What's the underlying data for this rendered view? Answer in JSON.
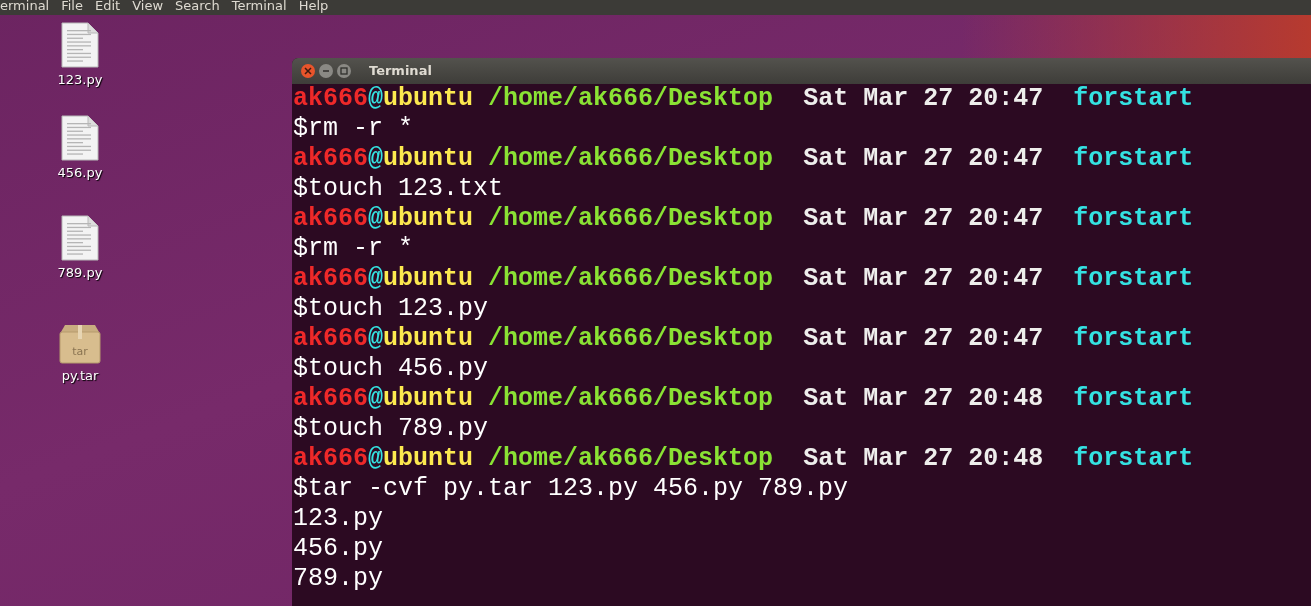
{
  "menu_bar": {
    "items": [
      "erminal",
      "File",
      "Edit",
      "View",
      "Search",
      "Terminal",
      "Help"
    ]
  },
  "desktop_icons": [
    {
      "label": "123.py",
      "kind": "document"
    },
    {
      "label": "456.py",
      "kind": "document"
    },
    {
      "label": "789.py",
      "kind": "document"
    },
    {
      "label": "py.tar",
      "kind": "archive",
      "badge": "tar"
    }
  ],
  "terminal": {
    "title": "Terminal",
    "lines": [
      {
        "kind": "prompt",
        "user": "ak666",
        "at": "@",
        "host": "ubuntu",
        "path": "/home/ak666/Desktop",
        "date": "Sat Mar 27 20:47",
        "tag": "forstart"
      },
      {
        "kind": "command",
        "text": "$rm -r *"
      },
      {
        "kind": "prompt",
        "user": "ak666",
        "at": "@",
        "host": "ubuntu",
        "path": "/home/ak666/Desktop",
        "date": "Sat Mar 27 20:47",
        "tag": "forstart"
      },
      {
        "kind": "command",
        "text": "$touch 123.txt"
      },
      {
        "kind": "prompt",
        "user": "ak666",
        "at": "@",
        "host": "ubuntu",
        "path": "/home/ak666/Desktop",
        "date": "Sat Mar 27 20:47",
        "tag": "forstart"
      },
      {
        "kind": "command",
        "text": "$rm -r *"
      },
      {
        "kind": "prompt",
        "user": "ak666",
        "at": "@",
        "host": "ubuntu",
        "path": "/home/ak666/Desktop",
        "date": "Sat Mar 27 20:47",
        "tag": "forstart"
      },
      {
        "kind": "command",
        "text": "$touch 123.py"
      },
      {
        "kind": "prompt",
        "user": "ak666",
        "at": "@",
        "host": "ubuntu",
        "path": "/home/ak666/Desktop",
        "date": "Sat Mar 27 20:47",
        "tag": "forstart"
      },
      {
        "kind": "command",
        "text": "$touch 456.py"
      },
      {
        "kind": "prompt",
        "user": "ak666",
        "at": "@",
        "host": "ubuntu",
        "path": "/home/ak666/Desktop",
        "date": "Sat Mar 27 20:48",
        "tag": "forstart"
      },
      {
        "kind": "command",
        "text": "$touch 789.py"
      },
      {
        "kind": "prompt",
        "user": "ak666",
        "at": "@",
        "host": "ubuntu",
        "path": "/home/ak666/Desktop",
        "date": "Sat Mar 27 20:48",
        "tag": "forstart"
      },
      {
        "kind": "command",
        "text": "$tar -cvf py.tar 123.py 456.py 789.py"
      },
      {
        "kind": "output",
        "text": "123.py"
      },
      {
        "kind": "output",
        "text": "456.py"
      },
      {
        "kind": "output",
        "text": "789.py"
      }
    ]
  }
}
